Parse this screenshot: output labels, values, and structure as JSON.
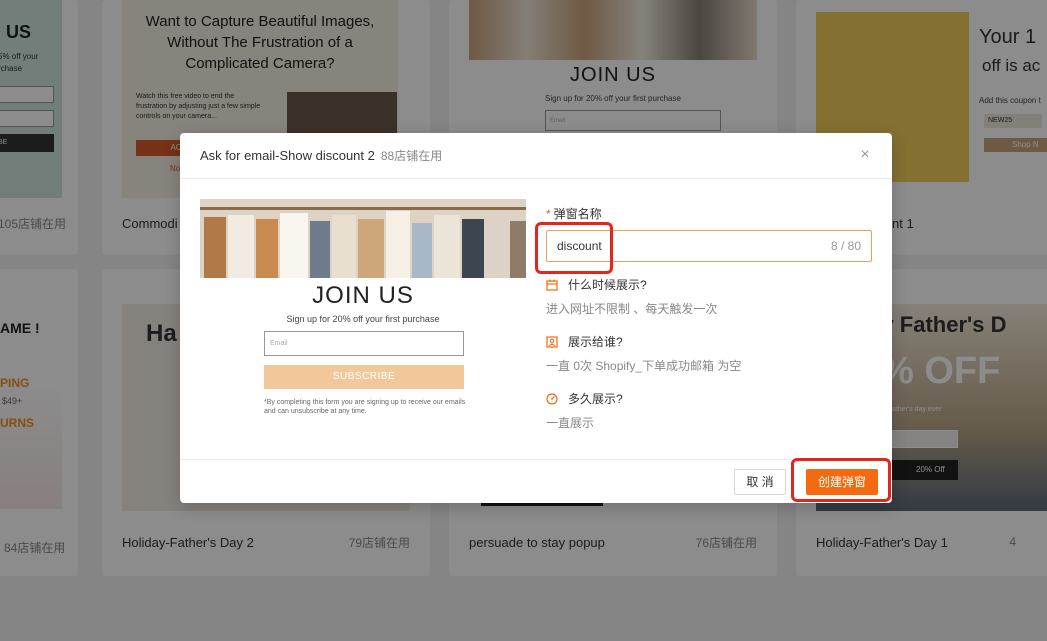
{
  "background_cards": [
    {
      "title": "",
      "usage": "105店铺在用",
      "thumb_lines": [
        "US",
        "5% off your",
        "rchase",
        "IBE"
      ]
    },
    {
      "title": "Commodi",
      "usage": "",
      "thumb_lines": [
        "Want to Capture Beautiful Images,",
        "Without The Frustration of a",
        "Complicated Camera?",
        "Watch this free video to end the frustration by adjusting just a few simple controls on your camera...",
        "AC",
        "No"
      ]
    },
    {
      "title": "",
      "usage": "",
      "thumb_lines": [
        "JOIN US",
        "Sign up for 20% off your first purchase",
        "Email"
      ]
    },
    {
      "title": "nt 1",
      "usage": "",
      "thumb_lines": [
        "Your 1",
        "off is ac",
        "Add this coupon t",
        "NEW25",
        "Shop N"
      ]
    },
    {
      "title": "",
      "usage": "84店铺在用",
      "thumb_lines": [
        "AME !",
        "PING",
        "$49+",
        "URNS"
      ]
    },
    {
      "title": "Holiday-Father's Day 2",
      "usage": "79店铺在用",
      "thumb_lines": [
        "Ha"
      ]
    },
    {
      "title": "persuade to stay popup",
      "usage": "76店铺在用",
      "thumb_lines": []
    },
    {
      "title": "Holiday-Father's Day 1",
      "usage": "4",
      "thumb_lines": [
        "py Father's D",
        "% OFF",
        "father's day ever",
        "20% Off"
      ]
    }
  ],
  "modal": {
    "title": "Ask for email-Show discount 2",
    "subtitle": "88店铺在用",
    "close_label": "×",
    "preview": {
      "heading": "JOIN US",
      "text": "Sign up for 20% off your first purchase",
      "email_placeholder": "Email",
      "subscribe_label": "SUBSCRIBE",
      "disclaimer": "*By completing this form you are signing up to receive our emails and can unsubscribe at any time."
    },
    "form": {
      "name_label": "弹窗名称",
      "required_mark": "*",
      "name_value": "discount",
      "name_count": "8 / 80",
      "when_label": "什么时候展示?",
      "when_desc": "进入网址不限制 、每天触发一次",
      "who_label": "展示给谁?",
      "who_desc": "一直 0次 Shopify_下单成功邮箱 为空",
      "how_long_label": "多久展示?",
      "how_long_desc": "一直展示"
    },
    "footer": {
      "cancel_label": "取 消",
      "create_label": "创建弹窗"
    }
  },
  "colors": {
    "accent": "#f36a10",
    "highlight": "#e5251c",
    "overlay": "rgba(0,0,0,0.45)"
  }
}
